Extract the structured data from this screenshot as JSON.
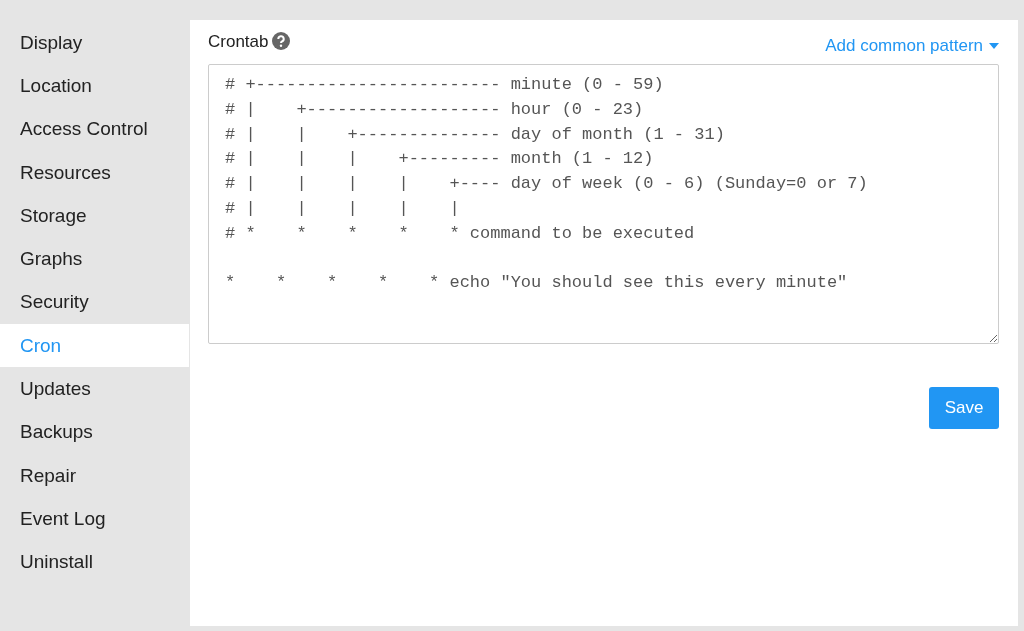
{
  "sidebar": {
    "items": [
      {
        "label": "Display",
        "selected": false
      },
      {
        "label": "Location",
        "selected": false
      },
      {
        "label": "Access Control",
        "selected": false
      },
      {
        "label": "Resources",
        "selected": false
      },
      {
        "label": "Storage",
        "selected": false
      },
      {
        "label": "Graphs",
        "selected": false
      },
      {
        "label": "Security",
        "selected": false
      },
      {
        "label": "Cron",
        "selected": true
      },
      {
        "label": "Updates",
        "selected": false
      },
      {
        "label": "Backups",
        "selected": false
      },
      {
        "label": "Repair",
        "selected": false
      },
      {
        "label": "Event Log",
        "selected": false
      },
      {
        "label": "Uninstall",
        "selected": false
      }
    ]
  },
  "crontab": {
    "label": "Crontab",
    "pattern_menu": "Add common pattern",
    "value": "# +------------------------ minute (0 - 59)\n# |    +------------------- hour (0 - 23)\n# |    |    +-------------- day of month (1 - 31)\n# |    |    |    +--------- month (1 - 12)\n# |    |    |    |    +---- day of week (0 - 6) (Sunday=0 or 7)\n# |    |    |    |    |\n# *    *    *    *    * command to be executed\n\n*    *    *    *    * echo \"You should see this every minute\""
  },
  "buttons": {
    "save": "Save"
  }
}
